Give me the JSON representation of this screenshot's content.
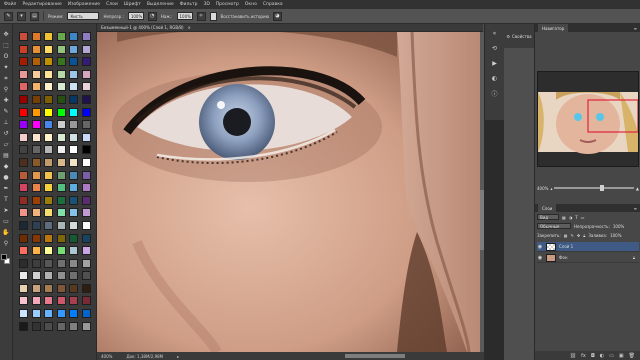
{
  "menu": [
    "Файл",
    "Редактирование",
    "Изображение",
    "Слои",
    "Шрифт",
    "Выделение",
    "Фильтр",
    "3D",
    "Просмотр",
    "Окно",
    "Справка"
  ],
  "options": {
    "mode_label": "Режим:",
    "mode_value": "Кисть",
    "opacity_label": "Непрозр.:",
    "opacity_value": "100%",
    "flow_label": "Наж.:",
    "flow_value": "100%",
    "history_label": "Восстановить историю"
  },
  "document": {
    "tab_title": "Безымянный-1 @ 400% (Слой 1, RGB/8)",
    "zoom": "400%",
    "doc_info": "Док: 1,38М/2,98М",
    "vscroll_fraction": 0.63,
    "hscroll_fraction": 0.65
  },
  "tools": [
    "move-icon",
    "marquee-icon",
    "lasso-icon",
    "magic-wand-icon",
    "crop-icon",
    "eyedropper-icon",
    "healing-icon",
    "brush-icon",
    "stamp-icon",
    "history-brush-icon",
    "eraser-icon",
    "gradient-icon",
    "blur-icon",
    "dodge-icon",
    "pen-icon",
    "type-icon",
    "path-select-icon",
    "shape-icon",
    "hand-icon",
    "zoom-icon"
  ],
  "swatch_colors": [
    "#c94d3c",
    "#e07a2a",
    "#f1c232",
    "#6aa84f",
    "#3d85c6",
    "#8e7cc3",
    "#cc4125",
    "#e69138",
    "#ffd966",
    "#93c47d",
    "#6fa8dc",
    "#b4a7d6",
    "#a61c00",
    "#b45f06",
    "#bf9000",
    "#38761d",
    "#0b5394",
    "#351c75",
    "#ea9999",
    "#f9cb9c",
    "#ffe599",
    "#b6d7a8",
    "#9fc5e8",
    "#d5a6bd",
    "#e06666",
    "#f6b26b",
    "#fff2cc",
    "#d9ead3",
    "#cfe2f3",
    "#ead1dc",
    "#990000",
    "#783f04",
    "#7f6000",
    "#274e13",
    "#073763",
    "#20124d",
    "#ff0000",
    "#ff9900",
    "#ffff00",
    "#00ff00",
    "#00ffff",
    "#0000ff",
    "#9900ff",
    "#ff00ff",
    "#4a86e8",
    "#cccccc",
    "#999999",
    "#666666",
    "#f4cccc",
    "#fce5cd",
    "#fff2cc",
    "#d9ead3",
    "#d0e0e3",
    "#c9daf8",
    "#434343",
    "#666666",
    "#b7b7b7",
    "#efefef",
    "#ffffff",
    "#000000",
    "#4d2f1f",
    "#8b5a2b",
    "#c29b6c",
    "#d8b98c",
    "#f3e3c7",
    "#ffffff",
    "#b85c38",
    "#e2974c",
    "#f2c14e",
    "#6d9f71",
    "#4a8ab5",
    "#7a5ea8",
    "#d4435f",
    "#e8834a",
    "#f4d03f",
    "#52be80",
    "#5dade2",
    "#af7ac5",
    "#922b21",
    "#a04000",
    "#9a7d0a",
    "#196f3d",
    "#1a5276",
    "#5b2c6f",
    "#f1948a",
    "#f0b27a",
    "#f7dc6f",
    "#82e0aa",
    "#85c1e9",
    "#c39bd3",
    "#1c2833",
    "#2e4053",
    "#5d6d7e",
    "#aab7b8",
    "#d5dbdb",
    "#f8f9f9",
    "#6e2c00",
    "#873600",
    "#b9770e",
    "#7d6608",
    "#145a32",
    "#154360",
    "#ff6f61",
    "#ffb347",
    "#fdfd96",
    "#77dd77",
    "#aec6cf",
    "#cba6e2",
    "#2c2c2c",
    "#3e3e3e",
    "#575757",
    "#707070",
    "#8a8a8a",
    "#a3a3a3",
    "#eaeaea",
    "#d0d0d0",
    "#b0b0b0",
    "#909090",
    "#707070",
    "#505050",
    "#e8d1b0",
    "#c9a27e",
    "#a67c52",
    "#7e5736",
    "#57391f",
    "#2f1d0e",
    "#f8c3cd",
    "#f4a7b9",
    "#e87a90",
    "#d0576b",
    "#a83f4f",
    "#7a2a36",
    "#cce5ff",
    "#99ccff",
    "#66b2ff",
    "#3399ff",
    "#0080ff",
    "#0066cc",
    "#1a1a1a",
    "#333333",
    "#4d4d4d",
    "#666666",
    "#808080",
    "#999999"
  ],
  "right": {
    "navigator_tab": "Навигатор",
    "properties_label": "Свойства",
    "nav_zoom": "400%",
    "layers_tab": "Слои",
    "kind_label": "Вид",
    "blend_value": "Обычные",
    "opacity_label": "Непрозрачность:",
    "opacity_value": "100%",
    "lock_label": "Закрепить:",
    "fill_label": "Заливка:",
    "fill_value": "100%",
    "layers": [
      {
        "name": "Слой 1",
        "selected": true
      },
      {
        "name": "Фон",
        "selected": false
      }
    ]
  },
  "colors": {
    "fg": "#000000",
    "bg": "#ffffff",
    "selection": "#3f5b85",
    "nav_frame": "#e0243b"
  }
}
